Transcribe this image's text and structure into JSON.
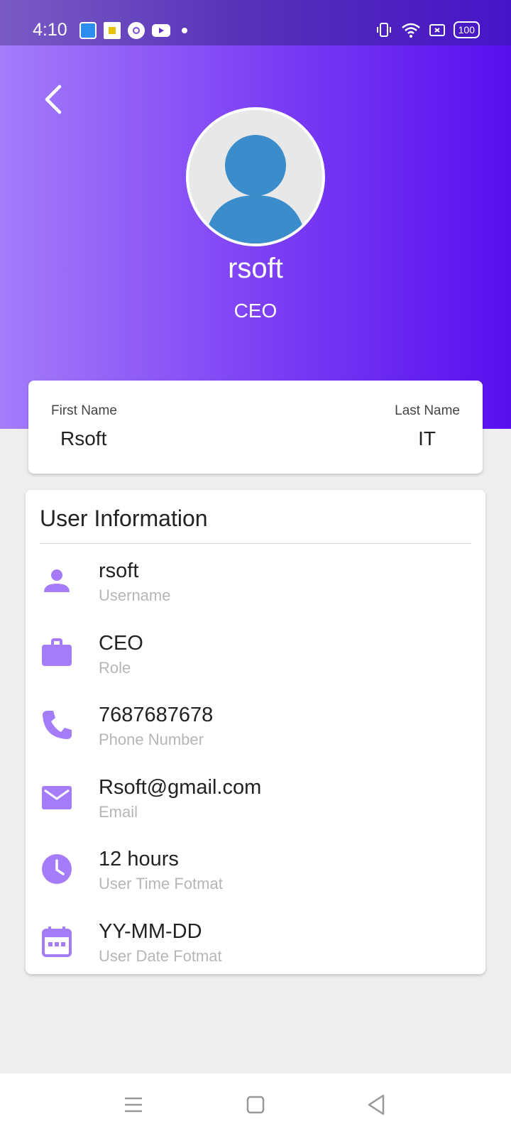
{
  "status_bar": {
    "time": "4:10",
    "notification_icons": [
      "app-icon",
      "news-icon",
      "chrome-icon",
      "youtube-icon"
    ],
    "battery": "100"
  },
  "profile": {
    "name": "rsoft",
    "role": "CEO"
  },
  "name_card": {
    "first_name_label": "First Name",
    "first_name": "Rsoft",
    "last_name_label": "Last Name",
    "last_name": "IT"
  },
  "user_info": {
    "title": "User Information",
    "items": [
      {
        "value": "rsoft",
        "label": "Username",
        "icon": "person-icon"
      },
      {
        "value": "CEO",
        "label": "Role",
        "icon": "briefcase-icon"
      },
      {
        "value": "7687687678",
        "label": "Phone Number",
        "icon": "phone-icon"
      },
      {
        "value": "Rsoft@gmail.com",
        "label": "Email",
        "icon": "mail-icon"
      },
      {
        "value": "12 hours",
        "label": "User Time Fotmat",
        "icon": "clock-icon"
      },
      {
        "value": "YY-MM-DD",
        "label": "User Date Fotmat",
        "icon": "calendar-icon"
      }
    ]
  },
  "colors": {
    "accent": "#a47cf9",
    "header_start": "#a47cf9",
    "header_end": "#5810ee",
    "avatar": "#3a8ccb"
  }
}
